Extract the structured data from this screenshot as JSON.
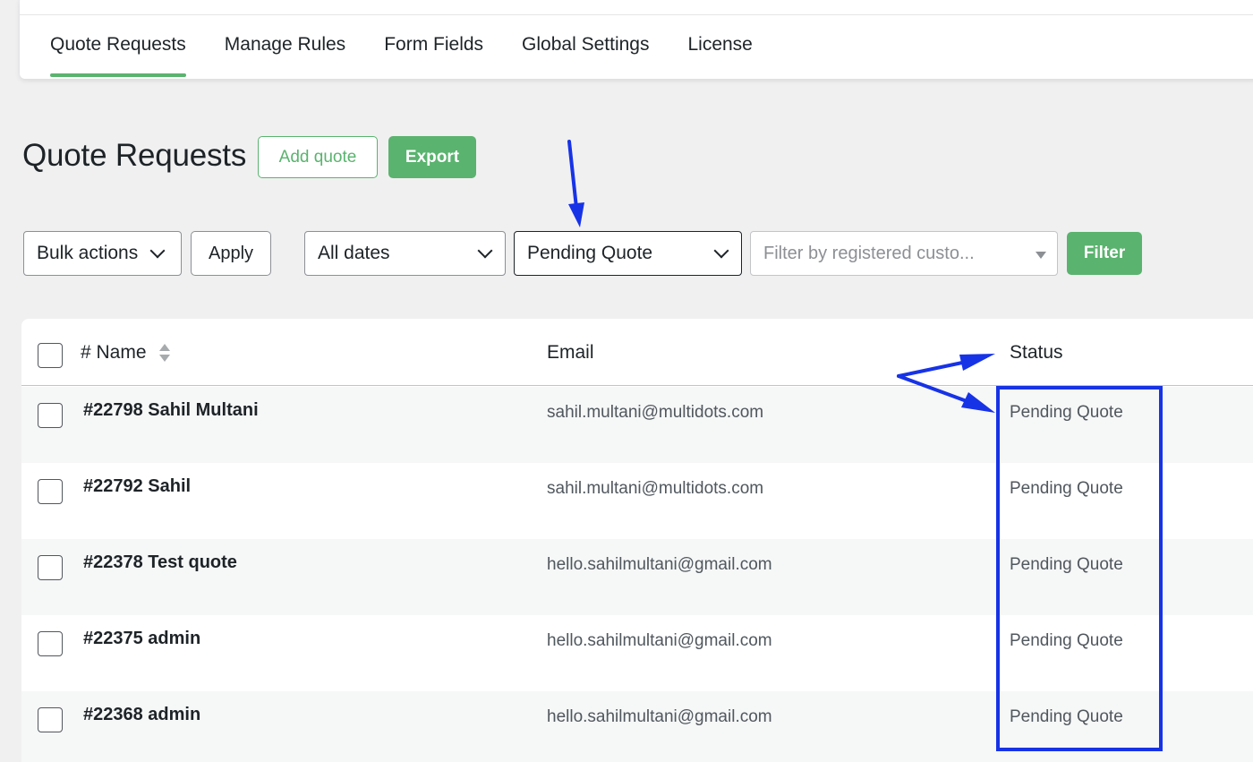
{
  "nav": {
    "tabs": [
      {
        "label": "Quote Requests",
        "active": true
      },
      {
        "label": "Manage Rules"
      },
      {
        "label": "Form Fields"
      },
      {
        "label": "Global Settings"
      },
      {
        "label": "License"
      }
    ]
  },
  "header": {
    "title": "Quote Requests",
    "add_quote_label": "Add quote",
    "export_label": "Export"
  },
  "filters": {
    "bulk_actions": "Bulk actions",
    "apply_label": "Apply",
    "dates": "All dates",
    "status": "Pending Quote",
    "customer_placeholder": "Filter by registered custo...",
    "filter_label": "Filter"
  },
  "table": {
    "columns": {
      "name": "# Name",
      "email": "Email",
      "status": "Status"
    },
    "rows": [
      {
        "name": "#22798 Sahil Multani",
        "email": "sahil.multani@multidots.com",
        "status": "Pending Quote"
      },
      {
        "name": "#22792 Sahil",
        "email": "sahil.multani@multidots.com",
        "status": "Pending Quote"
      },
      {
        "name": "#22378 Test quote",
        "email": "hello.sahilmultani@gmail.com",
        "status": "Pending Quote"
      },
      {
        "name": "#22375 admin",
        "email": "hello.sahilmultani@gmail.com",
        "status": "Pending Quote"
      },
      {
        "name": "#22368 admin",
        "email": "hello.sahilmultani@gmail.com",
        "status": "Pending Quote"
      }
    ]
  },
  "colors": {
    "accent_green": "#5ab36e",
    "annotation_blue": "#1733e6"
  }
}
